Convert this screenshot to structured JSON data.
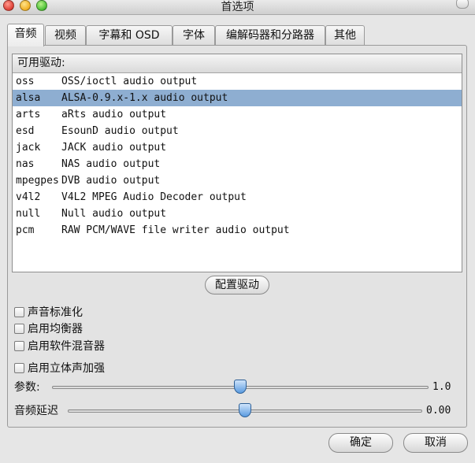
{
  "window": {
    "title": "首选项"
  },
  "tabs": [
    {
      "label": "音频",
      "active": true
    },
    {
      "label": "视频"
    },
    {
      "label": "字幕和 OSD"
    },
    {
      "label": "字体"
    },
    {
      "label": "编解码器和分路器"
    },
    {
      "label": "其他"
    }
  ],
  "drivers": {
    "header": "可用驱动:",
    "selected": "alsa",
    "rows": [
      {
        "name": "oss",
        "description": "OSS/ioctl audio output"
      },
      {
        "name": "alsa",
        "description": "ALSA-0.9.x-1.x audio output"
      },
      {
        "name": "arts",
        "description": "aRts audio output"
      },
      {
        "name": "esd",
        "description": "EsounD audio output"
      },
      {
        "name": "jack",
        "description": "JACK audio output"
      },
      {
        "name": "nas",
        "description": "NAS audio output"
      },
      {
        "name": "mpegpes",
        "description": "DVB audio output"
      },
      {
        "name": "v4l2",
        "description": "V4L2 MPEG Audio Decoder output"
      },
      {
        "name": "null",
        "description": "Null audio output"
      },
      {
        "name": "pcm",
        "description": "RAW PCM/WAVE file writer audio output"
      }
    ]
  },
  "configure_button": "配置驱动",
  "options": {
    "normalize": {
      "label": "声音标准化",
      "checked": false
    },
    "equalizer": {
      "label": "启用均衡器",
      "checked": false
    },
    "software_mixer": {
      "label": "启用软件混音器",
      "checked": false
    },
    "extra_stereo": {
      "label": "启用立体声加强",
      "checked": false
    }
  },
  "sliders": {
    "coefficient": {
      "label": "参数:",
      "value": "1.0",
      "fraction": 0.5
    },
    "delay": {
      "label": "音频延迟",
      "value": "0.00",
      "fraction": 0.5
    }
  },
  "buttons": {
    "ok": "确定",
    "cancel": "取消"
  },
  "colors": {
    "selection": "#8eaed1",
    "slider_knob": "#5a9be0"
  }
}
